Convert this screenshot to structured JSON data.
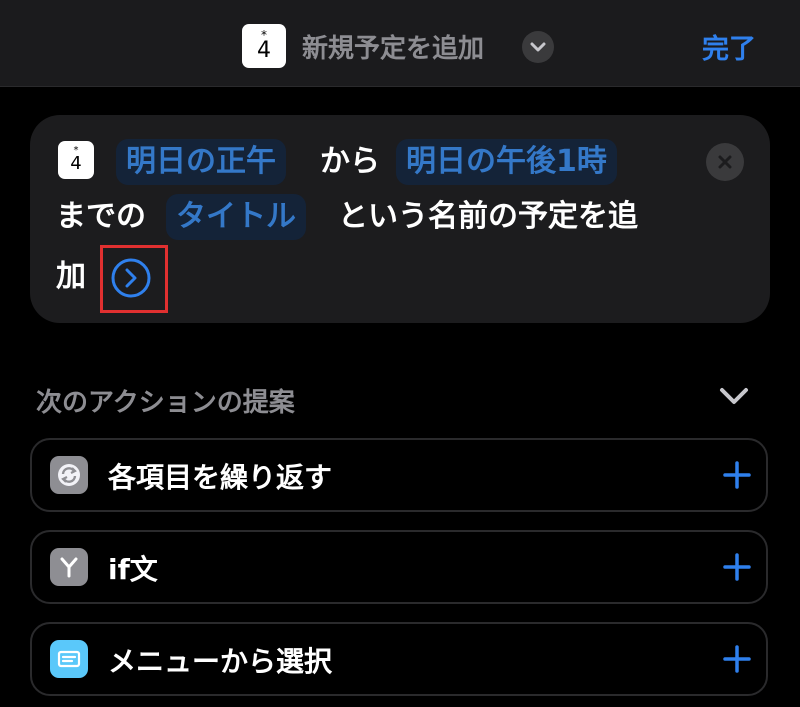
{
  "topbar": {
    "calendar_icon": {
      "mark": "*",
      "number": "4"
    },
    "title": "新規予定を追加",
    "done_label": "完了"
  },
  "action_card": {
    "calendar_icon": {
      "mark": "*",
      "number": "4"
    },
    "start_token": "明日の正午",
    "text_from": "から",
    "end_token": "明日の午後1時",
    "text_until": "までの",
    "title_token": "タイトル",
    "text_named": "という名前の予定を追",
    "text_add": "加",
    "icons": [
      "calendar-icon",
      "close-icon",
      "chevron-right-circle-icon"
    ]
  },
  "suggestions": {
    "title": "次のアクションの提案",
    "items": [
      {
        "label": "各項目を繰り返す",
        "icon": "repeat-icon",
        "icon_color": "#8e8e93"
      },
      {
        "label": "if文",
        "icon": "branch-icon",
        "icon_color": "#8e8e93"
      },
      {
        "label": "メニューから選択",
        "icon": "menu-list-icon",
        "icon_color": "#5ac8fa"
      }
    ]
  },
  "colors": {
    "accent": "#2f80ed",
    "token_bg": "#142338",
    "token_text": "#3478c8",
    "highlight": "#e03030"
  }
}
